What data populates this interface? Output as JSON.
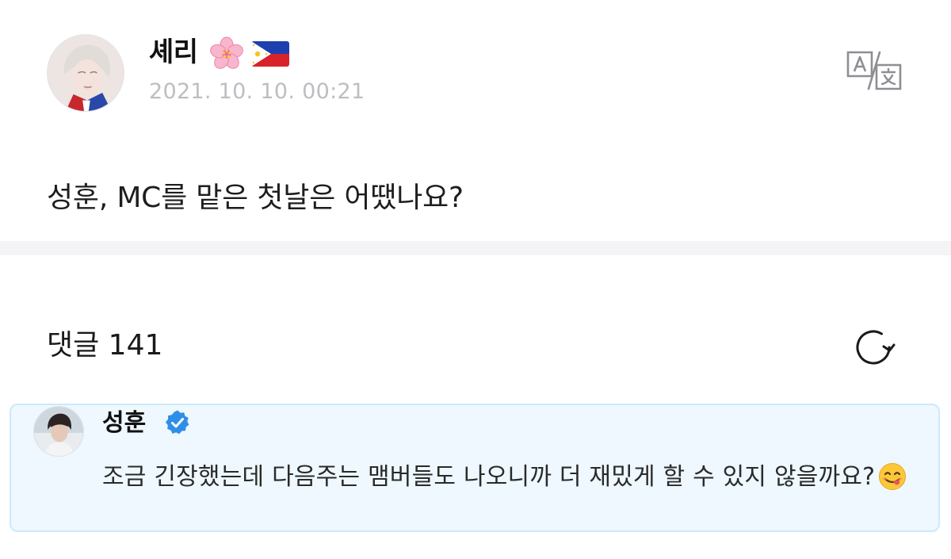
{
  "post": {
    "author_name": "셰리",
    "author_badges": [
      "cherry-blossom-emoji",
      "philippines-flag-emoji"
    ],
    "timestamp": "2021. 10. 10. 00:21",
    "content": "성훈, MC를 맡은 첫날은 어땠나요?",
    "translate_icon": "translate-icon"
  },
  "comments": {
    "header_label": "댓글 141",
    "refresh_icon": "refresh-icon",
    "highlighted": {
      "author": "성훈",
      "verified_icon": "verified-badge-icon",
      "text": "조금 긴장했는데 다음주는 맴버들도 나오니까 더 재밌게 할 수 있지 않을까요?",
      "emoji": "yum-face-emoji"
    }
  },
  "colors": {
    "accent_blue": "#2f8fe8",
    "highlight_bg": "#eef8fe",
    "highlight_border": "#cbeafb",
    "muted_text": "#bdbdc2"
  }
}
